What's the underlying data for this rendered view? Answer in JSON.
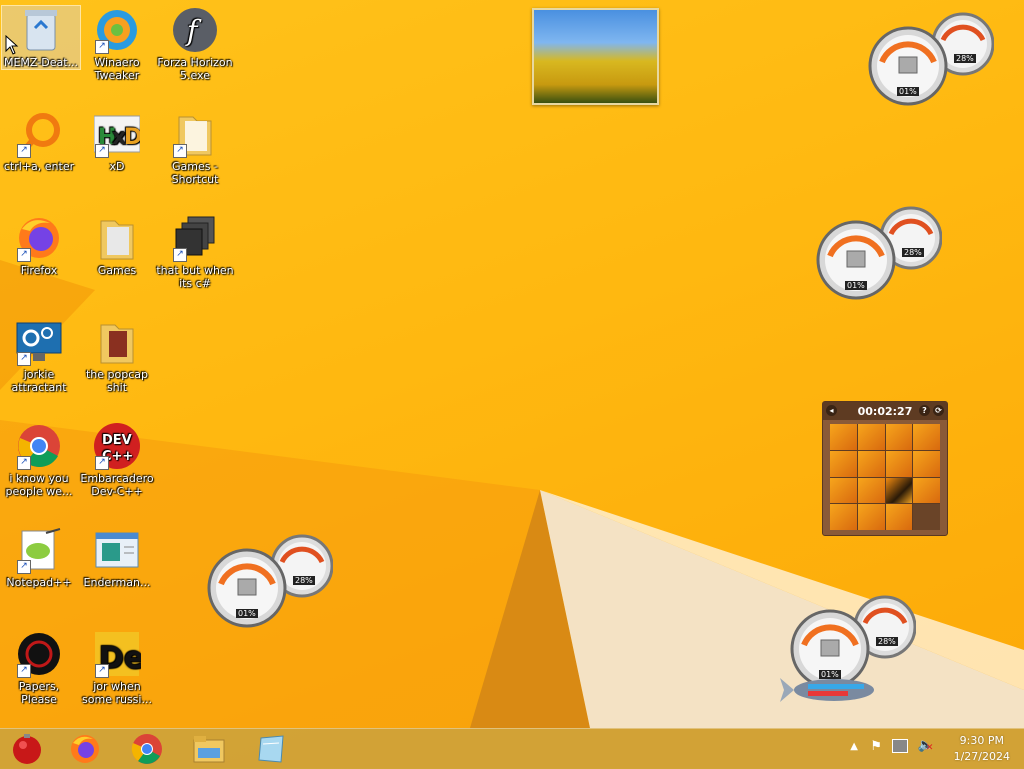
{
  "desktop": {
    "icons": [
      {
        "label": "MEMZ-Deat..."
      },
      {
        "label": "Winaero Tweaker"
      },
      {
        "label": "Forza Horizon 5.exe"
      },
      {
        "label": "ctrl+a, enter"
      },
      {
        "label": "xD"
      },
      {
        "label": "Games - Shortcut"
      },
      {
        "label": "Firefox"
      },
      {
        "label": "Games"
      },
      {
        "label": "that but when its c#"
      },
      {
        "label": "jorkie attractant"
      },
      {
        "label": "the popcap shit"
      },
      {
        "label": "i know you people we..."
      },
      {
        "label": "Embarcadero Dev-C++"
      },
      {
        "label": "Notepad++"
      },
      {
        "label": "Enderman..."
      },
      {
        "label": "Papers, Please"
      },
      {
        "label": "jor when some russi..."
      }
    ]
  },
  "gadgets": {
    "meter": {
      "cpu_label": "01%",
      "mem_label": "28%"
    },
    "puzzle": {
      "timer": "00:02:27"
    }
  },
  "taskbar": {
    "clock_time": "9:30 PM",
    "clock_date": "1/27/2024"
  },
  "colors": {
    "desktop": "#ffb810",
    "taskbar": "#cca03c"
  }
}
